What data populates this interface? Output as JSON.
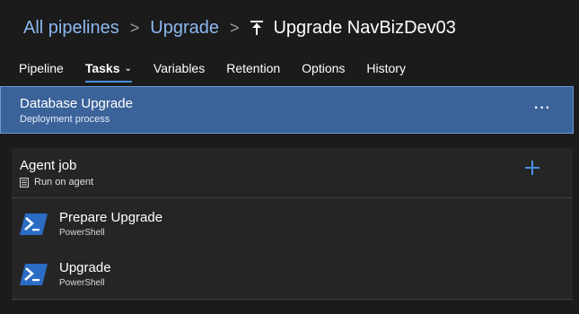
{
  "breadcrumb": {
    "all_pipelines": "All pipelines",
    "folder": "Upgrade",
    "current": "Upgrade NavBizDev03",
    "separator": ">"
  },
  "tabs": [
    {
      "label": "Pipeline",
      "active": false
    },
    {
      "label": "Tasks",
      "active": true
    },
    {
      "label": "Variables",
      "active": false
    },
    {
      "label": "Retention",
      "active": false
    },
    {
      "label": "Options",
      "active": false
    },
    {
      "label": "History",
      "active": false
    }
  ],
  "stage": {
    "title": "Database Upgrade",
    "subtitle": "Deployment process",
    "more": "···"
  },
  "agent_job": {
    "title": "Agent job",
    "subtitle": "Run on agent",
    "add_icon": "plus-icon"
  },
  "tasks": [
    {
      "title": "Prepare Upgrade",
      "subtitle": "PowerShell",
      "icon": "powershell-icon"
    },
    {
      "title": "Upgrade",
      "subtitle": "PowerShell",
      "icon": "powershell-icon"
    }
  ],
  "colors": {
    "background": "#1b1b1b",
    "stage_bg": "#3b6299",
    "link": "#8cb8f0",
    "accent": "#4c8ee0",
    "powershell": "#2b6cc4"
  }
}
